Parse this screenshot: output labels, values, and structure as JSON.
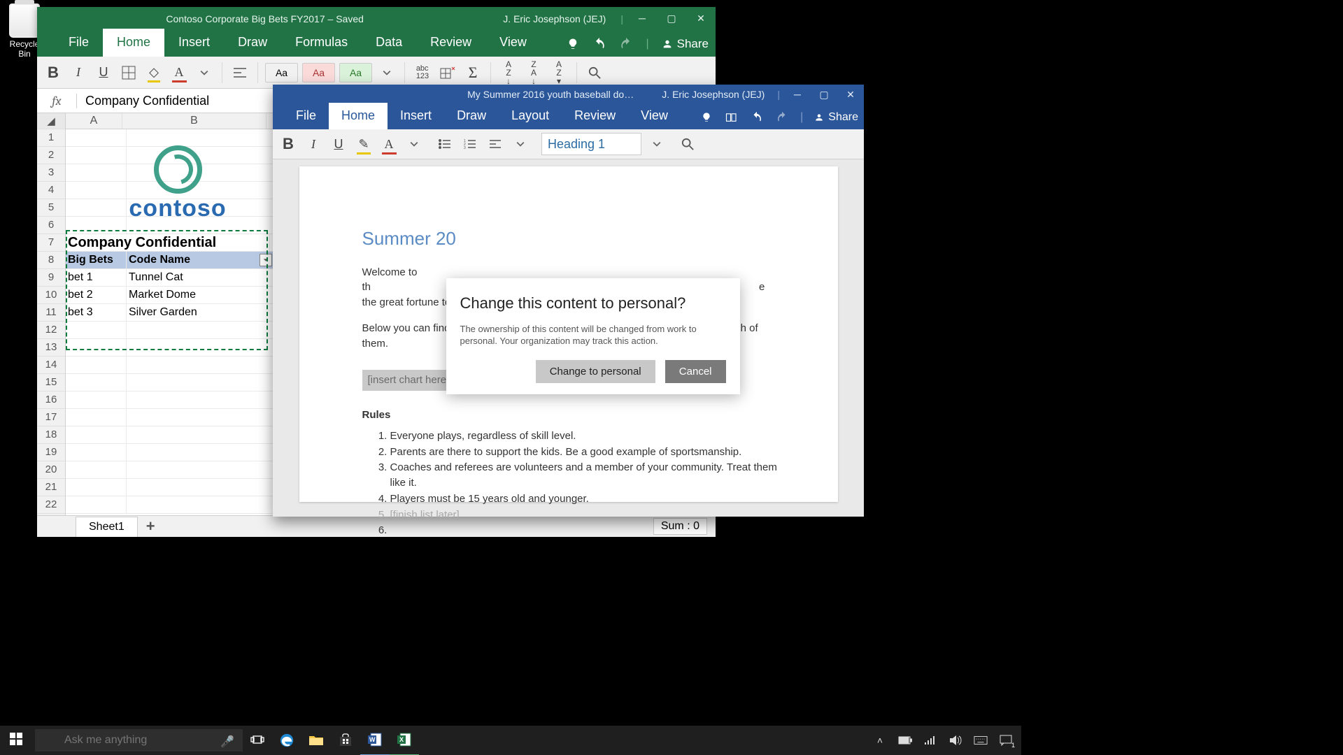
{
  "desktop": {
    "recycle_bin_label": "Recycle Bin"
  },
  "excel": {
    "title": "Contoso Corporate Big Bets FY2017 – Saved",
    "user": "J. Eric Josephson (JEJ)",
    "tabs": [
      "File",
      "Home",
      "Insert",
      "Draw",
      "Formulas",
      "Data",
      "Review",
      "View"
    ],
    "share_label": "Share",
    "ribbon": {
      "cell_style_default": "Aa",
      "cell_style_bad": "Aa",
      "cell_style_good": "Aa",
      "sort_label": "abc\n123"
    },
    "formula_bar_value": "Company Confidential",
    "columns": [
      "A",
      "B"
    ],
    "row_numbers": [
      "1",
      "2",
      "3",
      "4",
      "5",
      "6",
      "7",
      "8",
      "9",
      "10",
      "11",
      "12",
      "13",
      "14",
      "15",
      "16",
      "17",
      "18",
      "19",
      "20",
      "21",
      "22"
    ],
    "logo_text": "contoso",
    "a7": "Company Confidential",
    "header_a": "Big Bets",
    "header_b": "Code Name",
    "rows": [
      {
        "a": "bet 1",
        "b": "Tunnel Cat"
      },
      {
        "a": "bet 2",
        "b": "Market Dome"
      },
      {
        "a": "bet 3",
        "b": "Silver Garden"
      }
    ],
    "sheet_tab": "Sheet1",
    "status_sum": "Sum : 0"
  },
  "word": {
    "title": "My Summer 2016 youth baseball do…",
    "user": "J. Eric Josephson (JEJ)",
    "tabs": [
      "File",
      "Home",
      "Insert",
      "Draw",
      "Layout",
      "Review",
      "View"
    ],
    "share_label": "Share",
    "style_name": "Heading 1",
    "doc": {
      "heading": "Summer 20",
      "para1_left": "Welcome to th",
      "para1_right": "e the great fortune to have the use of the local AAA park for our home games!",
      "para2": "Below you can find a chart of the dates of all of our games and the location of each of them.",
      "placeholder": "[insert chart here]",
      "rules_label": "Rules",
      "rules": [
        "Everyone plays, regardless of skill level.",
        "Parents are there to support the kids.  Be a good example of sportsmanship.",
        "Coaches and referees are volunteers and a member of your community.  Treat them like it.",
        "Players must be 15 years old and younger.",
        "[finish list later]",
        ""
      ]
    }
  },
  "dialog": {
    "title": "Change this content to personal?",
    "body": "The ownership of this content will be changed from work to personal. Your organization may track this action.",
    "primary": "Change to personal",
    "cancel": "Cancel"
  },
  "taskbar": {
    "search_placeholder": "Ask me anything"
  }
}
